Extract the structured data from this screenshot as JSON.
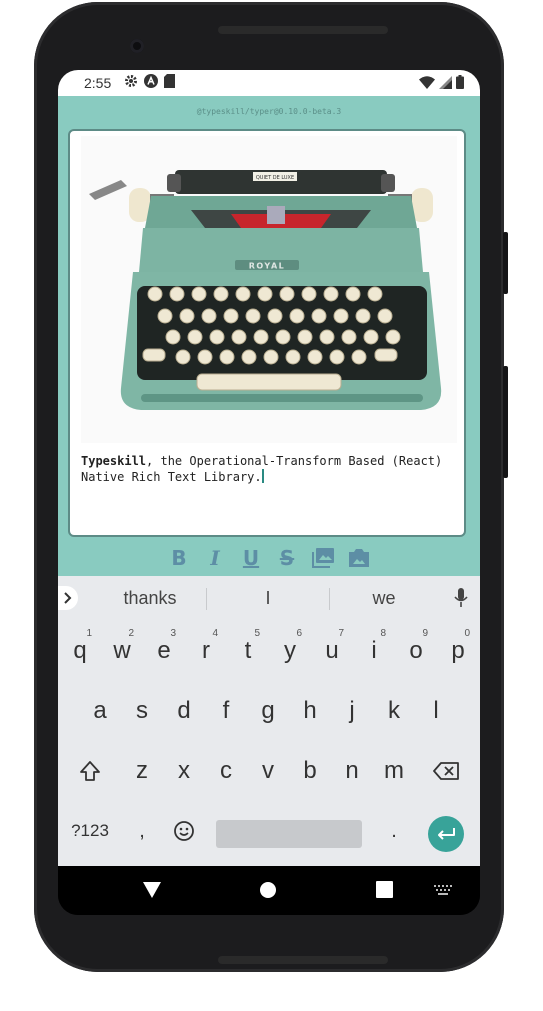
{
  "status": {
    "time": "2:55",
    "icons": [
      "gear-icon",
      "a-badge-icon",
      "sd-card-icon"
    ],
    "right_icons": [
      "wifi-icon",
      "signal-icon",
      "battery-icon"
    ]
  },
  "app": {
    "version": "@typeskill/typer@0.10.0-beta.3",
    "editor": {
      "bold_text": "Typeskill",
      "text": ", the Operational-Transform Based (React)",
      "text_line2": "Native Rich Text Library.",
      "image_label": "ROYAL",
      "image_badge": "QUIET DE LUXE"
    },
    "toolbar": {
      "bold": "B",
      "italic": "I",
      "underline": "U",
      "strike": "S"
    },
    "colors": {
      "accent": "#89cbc0",
      "toolbar_icon": "#5d8ea5",
      "enter": "#38a399"
    }
  },
  "keyboard": {
    "suggestions": [
      "thanks",
      "I",
      "we"
    ],
    "row1": [
      {
        "k": "q",
        "h": "1"
      },
      {
        "k": "w",
        "h": "2"
      },
      {
        "k": "e",
        "h": "3"
      },
      {
        "k": "r",
        "h": "4"
      },
      {
        "k": "t",
        "h": "5"
      },
      {
        "k": "y",
        "h": "6"
      },
      {
        "k": "u",
        "h": "7"
      },
      {
        "k": "i",
        "h": "8"
      },
      {
        "k": "o",
        "h": "9"
      },
      {
        "k": "p",
        "h": "0"
      }
    ],
    "row2": [
      "a",
      "s",
      "d",
      "f",
      "g",
      "h",
      "j",
      "k",
      "l"
    ],
    "row3": [
      "z",
      "x",
      "c",
      "v",
      "b",
      "n",
      "m"
    ],
    "sym_label": "?123",
    "comma": ",",
    "period": "."
  }
}
